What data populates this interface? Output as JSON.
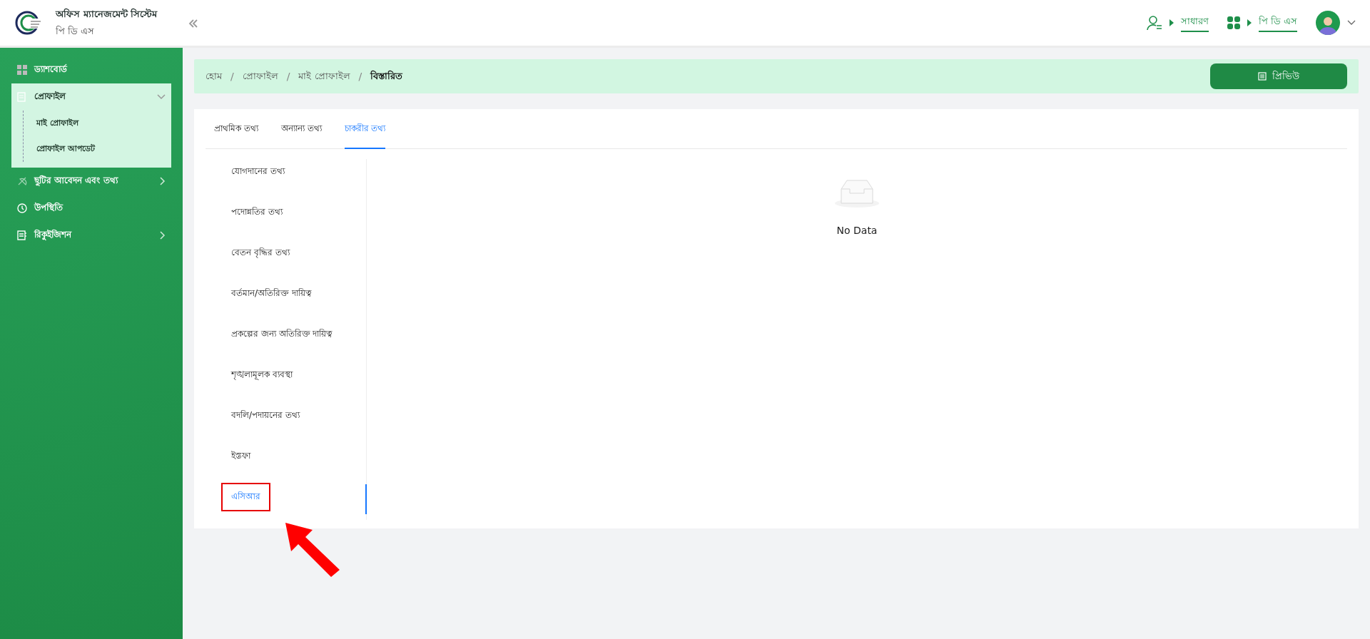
{
  "header": {
    "title": "অফিস ম্যানেজমেন্ট সিস্টেম",
    "subtitle": "পি ডি এস",
    "role_link": "সাধারণ",
    "module_link": "পি ডি এস"
  },
  "sidebar": {
    "items": [
      {
        "label": "ড্যাশবোর্ড",
        "selected": false
      },
      {
        "label": "প্রোফাইল",
        "selected": true,
        "expanded": true,
        "children": [
          {
            "label": "মাই প্রোফাইল",
            "selected": false
          },
          {
            "label": "প্রোফাইল আপডেট",
            "selected": false
          }
        ]
      },
      {
        "label": "ছুটির আবেদন এবং তথ্য",
        "selected": false,
        "expanded": false
      },
      {
        "label": "উপস্থিতি",
        "selected": false
      },
      {
        "label": "রিকুইজিশন",
        "selected": false,
        "expanded": false
      }
    ]
  },
  "breadcrumb": [
    "হোম",
    "প্রোফাইল",
    "মাই প্রোফাইল",
    "বিস্তারিত"
  ],
  "breadcrumb_separator": "/",
  "preview_button": "প্রিভিউ",
  "tabs": [
    {
      "label": "প্রাথমিক তথ্য",
      "selected": false
    },
    {
      "label": "অন্যান্য তথ্য",
      "selected": false
    },
    {
      "label": "চাকরীর তথ্য",
      "selected": true
    }
  ],
  "side_tabs": [
    {
      "label": "যোগদানের তথ্য",
      "selected": false,
      "highlighted": false
    },
    {
      "label": "পদোন্নতির তথ্য",
      "selected": false,
      "highlighted": false
    },
    {
      "label": "বেতন বৃদ্ধির তথ্য",
      "selected": false,
      "highlighted": false
    },
    {
      "label": "বর্তমান/অতিরিক্ত দায়িত্ব",
      "selected": false,
      "highlighted": false
    },
    {
      "label": "প্রকল্পের জন্য অতিরিক্ত দায়িত্ব",
      "selected": false,
      "highlighted": false
    },
    {
      "label": "শৃঙ্খলামূলক ব্যবস্থা",
      "selected": false,
      "highlighted": false
    },
    {
      "label": "বদলি/পদায়নের তথ্য",
      "selected": false,
      "highlighted": false
    },
    {
      "label": "ইস্তফা",
      "selected": false,
      "highlighted": false
    },
    {
      "label": "এসিআর",
      "selected": true,
      "highlighted": true
    }
  ],
  "empty": {
    "text": "No Data"
  }
}
